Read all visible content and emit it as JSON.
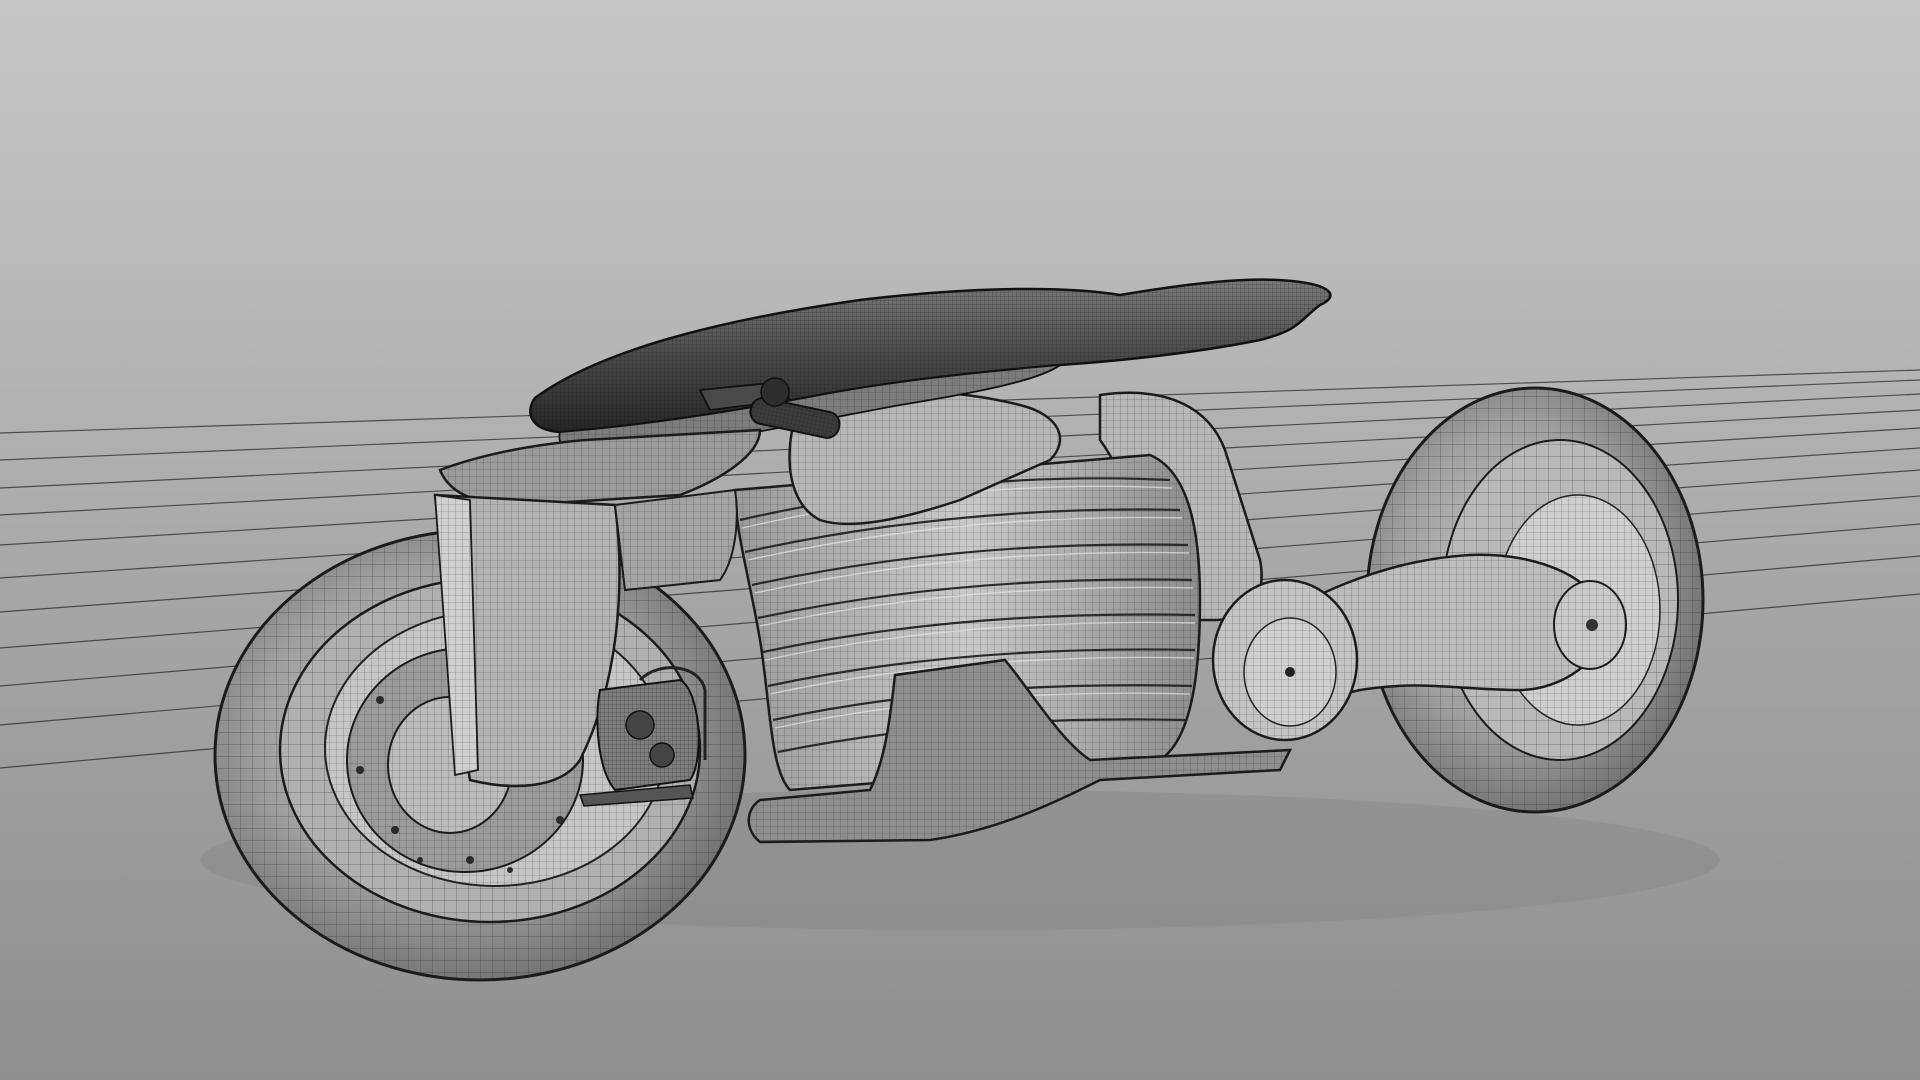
{
  "scene": {
    "subject": "wireframe-motorcycle-render",
    "view_mode": "wireframe-shaded",
    "colors": {
      "background_top": "#c7c7c7",
      "background_mid": "#a9a9a9",
      "floor": "#9c9c9c",
      "floor_bottom": "#8e8e8e",
      "surface_light": "#d4d4d4",
      "surface_mid": "#a8a8a8",
      "surface_dark": "#6e6e6e",
      "surface_black": "#2c2c2c",
      "wire": "#1a1a1a"
    },
    "icons": [
      "front-wheel-icon",
      "rear-wheel-icon",
      "seat-icon",
      "battery-body-icon",
      "brake-caliper-icon"
    ]
  }
}
